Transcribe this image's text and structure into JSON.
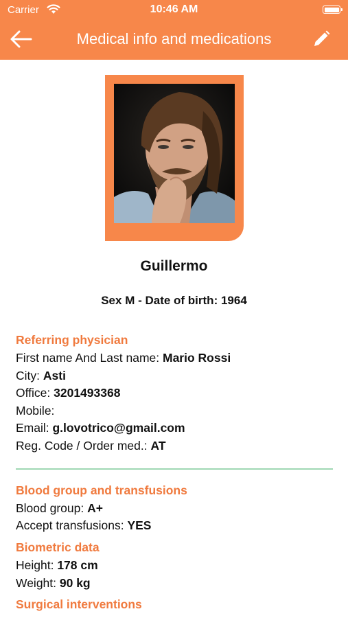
{
  "status_bar": {
    "carrier": "Carrier",
    "time": "10:46 AM"
  },
  "nav": {
    "title": "Medical info and medications"
  },
  "profile": {
    "name": "Guillermo",
    "sex_dob": "Sex M - Date of birth: 1964"
  },
  "referring_physician": {
    "title": "Referring physician",
    "name_label": "First name And Last name: ",
    "name_value": "Mario Rossi",
    "city_label": "City: ",
    "city_value": "Asti",
    "office_label": "Office: ",
    "office_value": "3201493368",
    "mobile_label": "Mobile:",
    "email_label": "Email: ",
    "email_value": "g.lovotrico@gmail.com",
    "reg_label": "Reg. Code / Order med.: ",
    "reg_value": "AT"
  },
  "blood": {
    "title": "Blood group and transfusions",
    "group_label": "Blood group: ",
    "group_value": "A+",
    "transfusions_label": "Accept transfusions: ",
    "transfusions_value": "YES"
  },
  "biometric": {
    "title": "Biometric data",
    "height_label": "Height: ",
    "height_value": "178 cm",
    "weight_label": "Weight: ",
    "weight_value": "90 kg"
  },
  "surgical": {
    "title": "Surgical interventions"
  },
  "colors": {
    "accent": "#f7874a",
    "section_title": "#f07a3e",
    "divider": "#9fd7b3"
  },
  "icons": [
    "wifi-icon",
    "battery-icon",
    "back-arrow-icon",
    "edit-pencil-icon"
  ]
}
